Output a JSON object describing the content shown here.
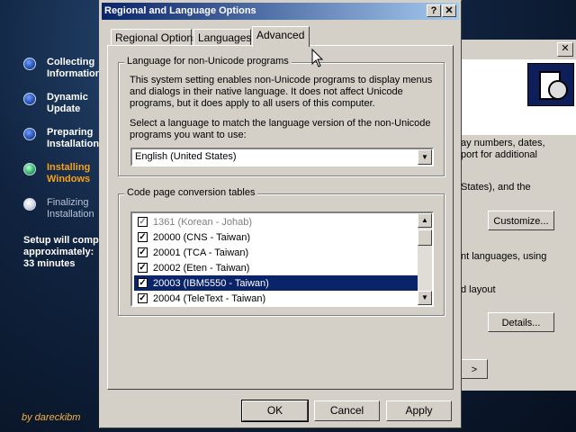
{
  "setup_sidebar": {
    "steps": [
      {
        "label": "Collecting\nInformation",
        "state": "done"
      },
      {
        "label": "Dynamic\nUpdate",
        "state": "done"
      },
      {
        "label": "Preparing\nInstallation",
        "state": "done"
      },
      {
        "label": "Installing\nWindows",
        "state": "active"
      },
      {
        "label": "Finalizing\nInstallation",
        "state": "pending"
      }
    ],
    "remaining": "Setup will comp\napproximately:\n33 minutes",
    "credit": "by dareckibm"
  },
  "background_dialog": {
    "close_glyph": "✕",
    "text1": "ay numbers, dates,\nport for additional",
    "text2": "States), and the",
    "customize_label": "Customize...",
    "text3": "nt languages, using",
    "text4": "d layout",
    "details_label": "Details...",
    "partial_button_label": ">"
  },
  "dialog": {
    "title": "Regional and Language Options",
    "help_glyph": "?",
    "close_glyph": "✕",
    "tabs": [
      {
        "label": "Regional Options",
        "active": false
      },
      {
        "label": "Languages",
        "active": false
      },
      {
        "label": "Advanced",
        "active": true
      }
    ],
    "nonunicode": {
      "legend": "Language for non-Unicode programs",
      "description": "This system setting enables non-Unicode programs to display menus\nand dialogs in their native language. It does not affect Unicode\nprograms, but it does apply to all users of this computer.",
      "prompt": "Select a language to match the language version of the non-Unicode\nprograms you want to use:",
      "selected_language": "English (United States)"
    },
    "codepages": {
      "legend": "Code page conversion tables",
      "items": [
        {
          "label": "1361  (Korean - Johab)",
          "checked": true,
          "disabled": true,
          "selected": false
        },
        {
          "label": "20000 (CNS - Taiwan)",
          "checked": true,
          "disabled": false,
          "selected": false
        },
        {
          "label": "20001 (TCA - Taiwan)",
          "checked": true,
          "disabled": false,
          "selected": false
        },
        {
          "label": "20002 (Eten - Taiwan)",
          "checked": true,
          "disabled": false,
          "selected": false
        },
        {
          "label": "20003 (IBM5550 - Taiwan)",
          "checked": true,
          "disabled": false,
          "selected": true
        },
        {
          "label": "20004 (TeleText - Taiwan)",
          "checked": true,
          "disabled": false,
          "selected": false
        }
      ]
    },
    "buttons": {
      "ok": "OK",
      "cancel": "Cancel",
      "apply": "Apply"
    }
  }
}
